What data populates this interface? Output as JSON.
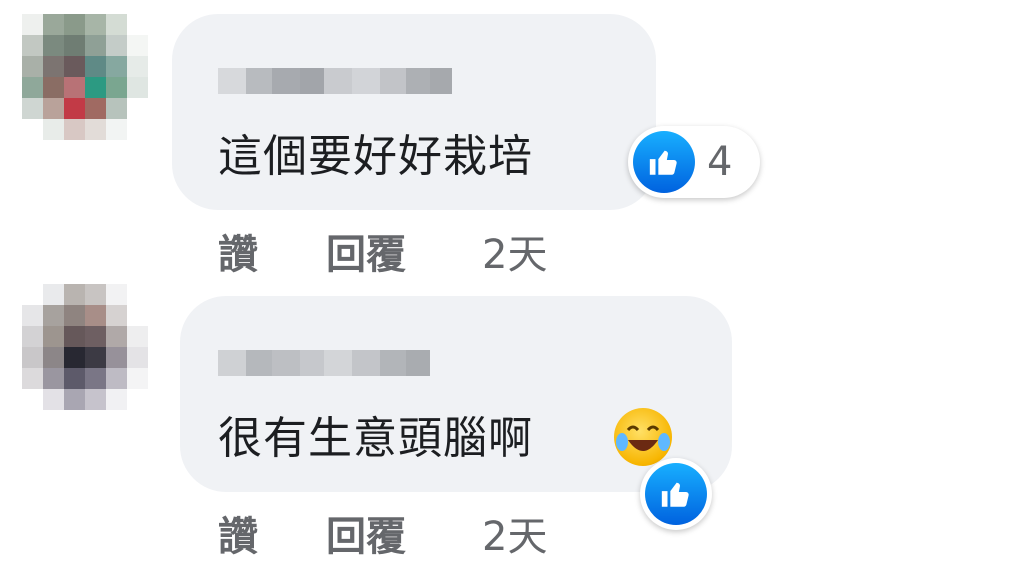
{
  "comments": [
    {
      "text": "這個要好好栽培",
      "like_count": "4",
      "actions": {
        "like": "讚",
        "reply": "回覆",
        "time": "2天"
      }
    },
    {
      "text": "很有生意頭腦啊",
      "emoji": "laughing-tears-emoji",
      "actions": {
        "like": "讚",
        "reply": "回覆",
        "time": "2天"
      }
    }
  ],
  "colors": {
    "bubble_bg": "#f0f2f5",
    "like_blue": "#0866ff",
    "secondary_text": "#65676b",
    "primary_text": "#1c1e21"
  },
  "icons": {
    "like": "thumbs-up-icon",
    "reaction": "laughing-tears-emoji"
  }
}
